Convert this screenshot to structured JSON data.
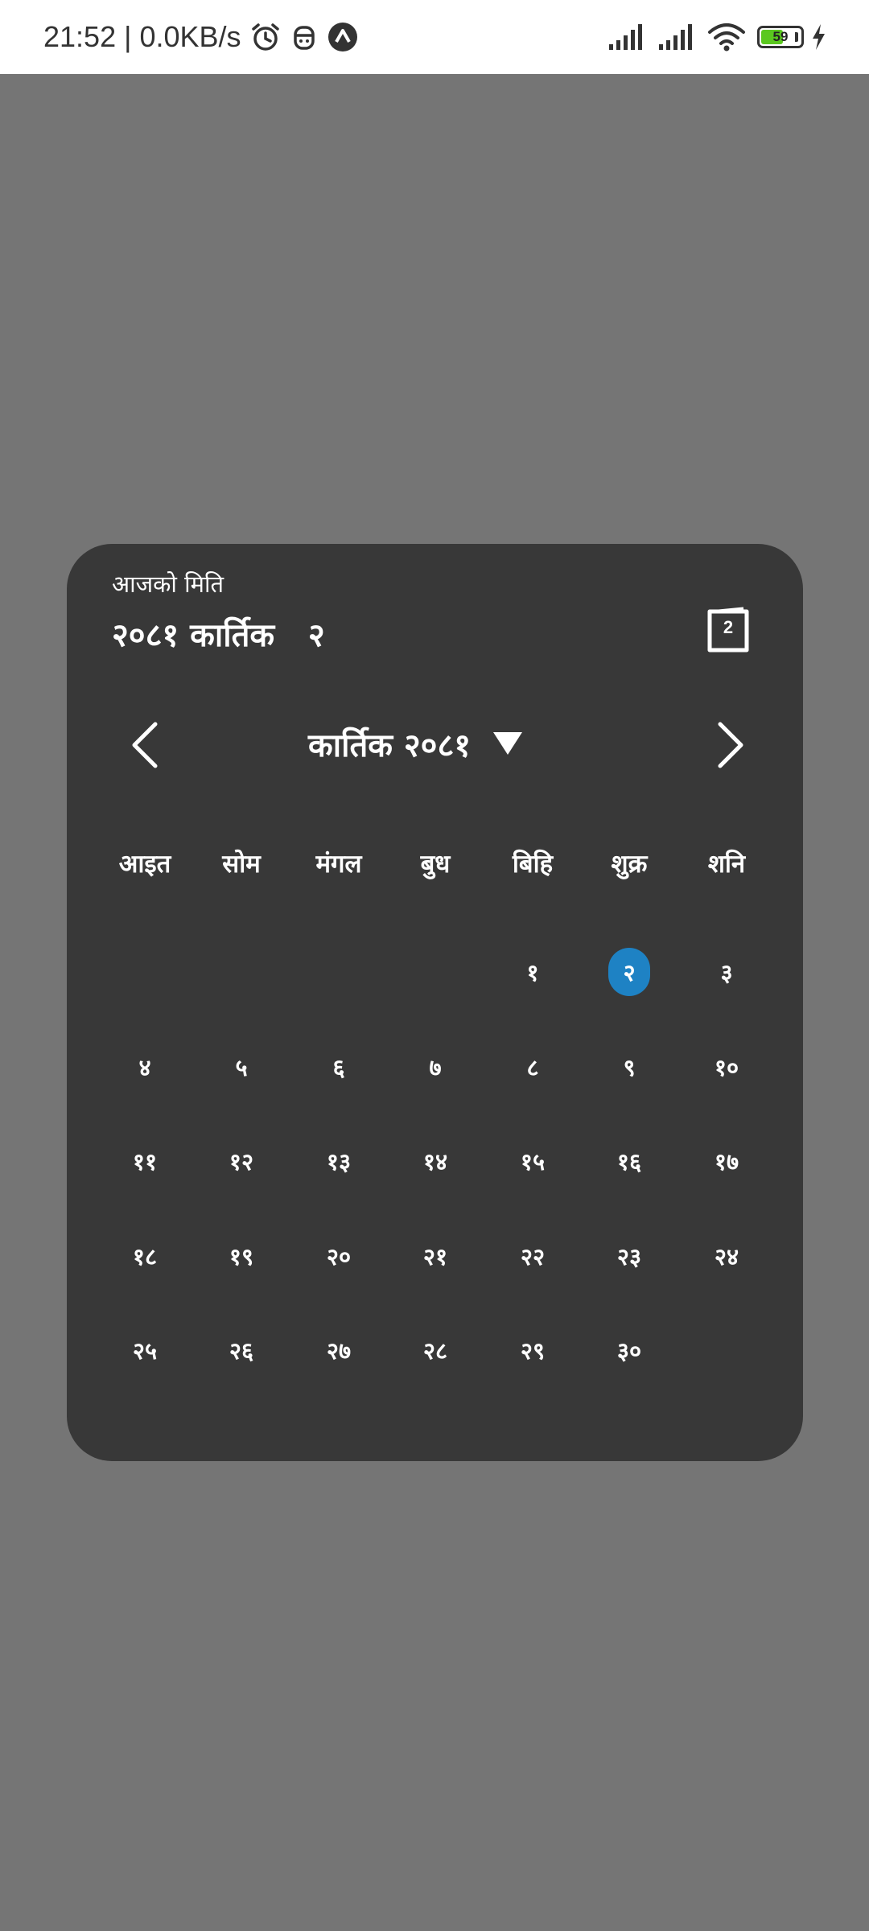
{
  "status_bar": {
    "time_speed": "21:52 | 0.0KB/s",
    "battery_level": 59,
    "battery_label": "59",
    "icons": [
      "alarm-icon",
      "notification-app-icon",
      "navigation-app-icon",
      "signal-icon",
      "signal-icon",
      "wifi-icon",
      "battery-icon",
      "charging-bolt-icon"
    ]
  },
  "widget": {
    "today_label": "आजको मिति",
    "today_date": "२०८१ कार्तिक   २",
    "today_button_label": "2",
    "month_label": "कार्तिक २०८१",
    "weekdays": [
      "आइत",
      "सोम",
      "मंगल",
      "बुध",
      "बिहि",
      "शुक्र",
      "शनि"
    ],
    "first_weekday_index": 4,
    "days": [
      "१",
      "२",
      "३",
      "४",
      "५",
      "६",
      "७",
      "८",
      "९",
      "१०",
      "११",
      "१२",
      "१३",
      "१४",
      "१५",
      "१६",
      "१७",
      "१८",
      "१९",
      "२०",
      "२१",
      "२२",
      "२३",
      "२४",
      "२५",
      "२६",
      "२७",
      "२८",
      "२९",
      "३०"
    ],
    "selected_day": "२",
    "accent_color": "#1e82c4",
    "card_color": "#383838",
    "background_color": "#757575"
  }
}
